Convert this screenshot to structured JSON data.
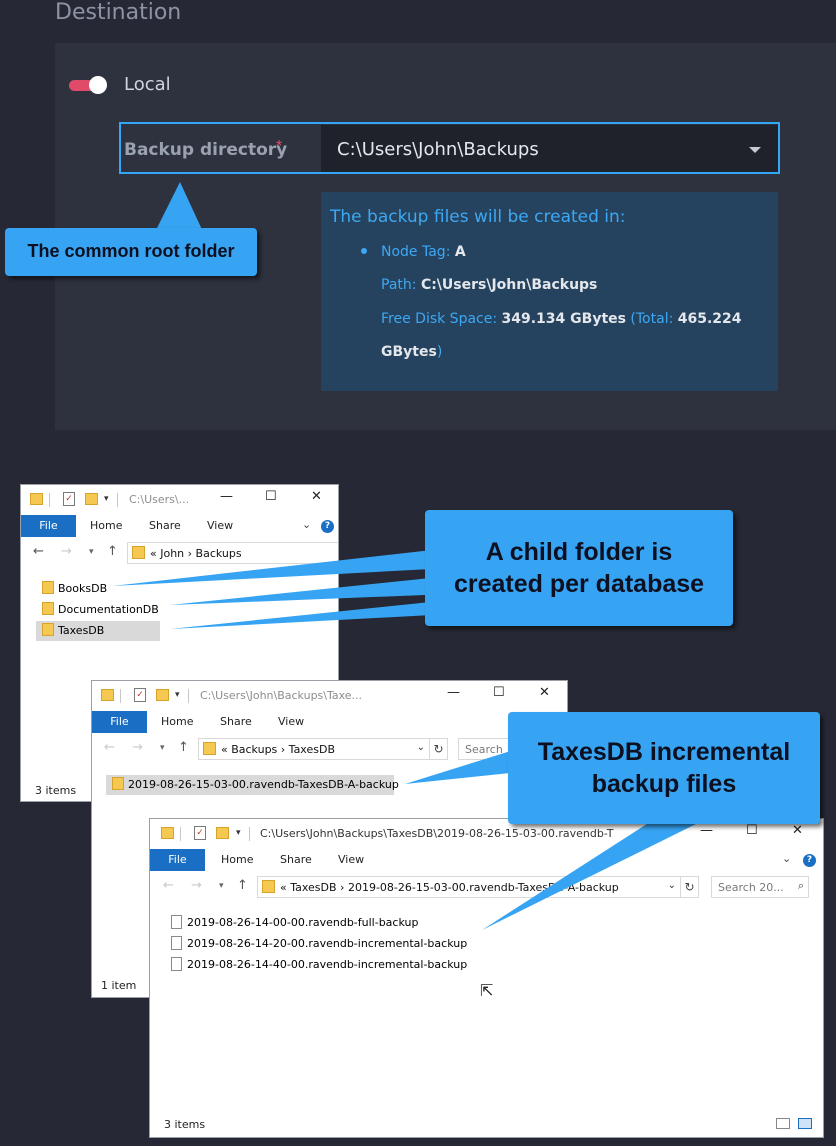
{
  "destination": {
    "title": "Destination",
    "local_label": "Local",
    "backup_directory": {
      "label": "Backup directory",
      "required_marker": "*",
      "value": "C:\\Users\\John\\Backups"
    },
    "info": {
      "title": "The backup files will be created in:",
      "node_tag_label": "Node Tag:",
      "node_tag_value": "A",
      "path_label": "Path:",
      "path_value": "C:\\Users\\John\\Backups",
      "free_label": "Free Disk Space:",
      "free_value": "349.134 GBytes",
      "total_label": "(Total:",
      "total_value": "465.224",
      "total_unit": "GBytes",
      "total_close": ")"
    },
    "colors": {
      "accent": "#3da8f5",
      "toggle": "#e04b6a"
    }
  },
  "callouts": {
    "root": "The common root folder",
    "child_line1": "A child folder is",
    "child_line2": "created per database",
    "taxes_line1": "TaxesDB incremental",
    "taxes_line2": "backup files"
  },
  "explorer1": {
    "title": "C:\\Users\\...",
    "tabs": [
      "File",
      "Home",
      "Share",
      "View"
    ],
    "help": "?",
    "breadcrumb": "«  John  ›  Backups",
    "items": [
      "BooksDB",
      "DocumentationDB",
      "TaxesDB"
    ],
    "status": "3 items"
  },
  "explorer2": {
    "title": "C:\\Users\\John\\Backups\\Taxe...",
    "tabs": [
      "File",
      "Home",
      "Share",
      "View"
    ],
    "breadcrumb": "«  Backups  ›  TaxesDB",
    "search": "Search",
    "items": [
      "2019-08-26-15-03-00.ravendb-TaxesDB-A-backup"
    ],
    "status": "1 item"
  },
  "explorer3": {
    "title": "C:\\Users\\John\\Backups\\TaxesDB\\2019-08-26-15-03-00.ravendb-T",
    "tabs": [
      "File",
      "Home",
      "Share",
      "View"
    ],
    "help": "?",
    "breadcrumb": "«  TaxesDB  ›  2019-08-26-15-03-00.ravendb-TaxesDB-A-backup",
    "search": "Search 20...",
    "items": [
      "2019-08-26-14-00-00.ravendb-full-backup",
      "2019-08-26-14-20-00.ravendb-incremental-backup",
      "2019-08-26-14-40-00.ravendb-incremental-backup"
    ],
    "status": "3 items"
  }
}
